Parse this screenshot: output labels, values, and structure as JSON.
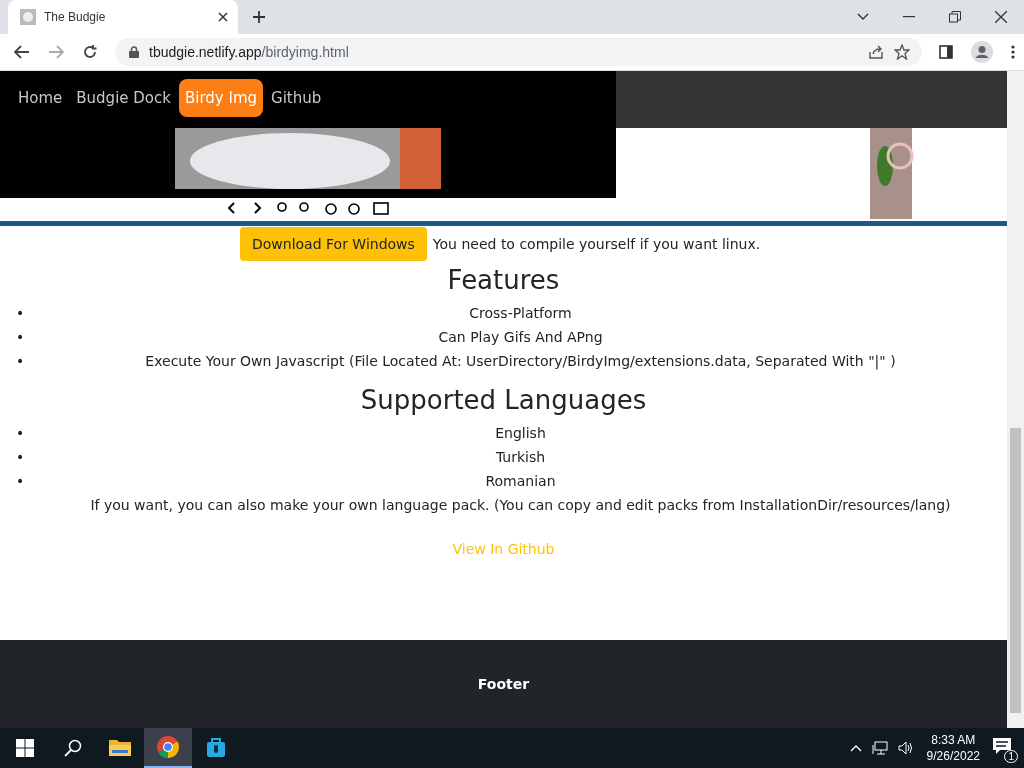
{
  "browser": {
    "tab_title": "The Budgie",
    "url_host": "tbudgie.netlify.app",
    "url_path": "/birdyimg.html"
  },
  "nav": [
    {
      "label": "Home",
      "selected": false
    },
    {
      "label": "Budgie Dock",
      "selected": false
    },
    {
      "label": "Birdy Img",
      "selected": true
    },
    {
      "label": "Github",
      "selected": false
    }
  ],
  "download": {
    "button": "Download For Windows",
    "note": "You need to compile yourself if you want linux."
  },
  "features": {
    "heading": "Features",
    "items": [
      {
        "marker": "•",
        "text": "Cross-Platform"
      },
      {
        "marker": "•",
        "text": "Can Play Gifs And APng"
      },
      {
        "marker": "•",
        "text": "Execute Your Own Javascript (File Located At: UserDirectory/BirdyImg/extensions.data, Separated With \"|\" )"
      }
    ]
  },
  "languages": {
    "heading": "Supported Languages",
    "items": [
      {
        "marker": "•",
        "text": "English"
      },
      {
        "marker": "•",
        "text": "Turkish"
      },
      {
        "marker": "•",
        "text": "Romanian"
      }
    ],
    "note": "If you want, you can also make your own language pack. (You can copy and edit packs from InstallationDir/resources/lang)"
  },
  "link": "View In Github",
  "footer": "Footer",
  "taskbar": {
    "apps": [
      {
        "kind": "folder",
        "selected": false
      },
      {
        "kind": "chrome",
        "selected": true
      },
      {
        "kind": "store",
        "selected": false
      }
    ],
    "time": "8:33 AM",
    "date": "9/26/2022",
    "notifications": "1"
  }
}
